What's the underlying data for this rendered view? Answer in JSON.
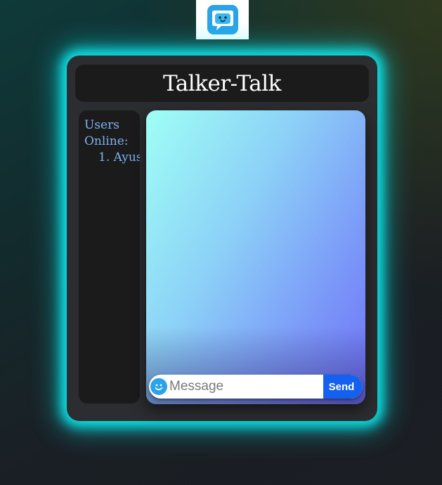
{
  "app": {
    "title": "Talker-Talk"
  },
  "logo": {
    "icon": "chat-bubble-face-icon",
    "color": "#2aa3e8"
  },
  "users_panel": {
    "heading": "Users Online:",
    "users": [
      {
        "number": "1.",
        "name": "Ayus"
      }
    ]
  },
  "chat": {
    "emoji_icon": "smiley-icon",
    "message_placeholder": "Message",
    "message_value": "",
    "send_label": "Send"
  },
  "colors": {
    "accent_glow": "#0fe3e8",
    "send_button": "#1361ee",
    "users_text": "#7fb2ee",
    "chat_gradient_start": "#9ffff5",
    "chat_gradient_end": "#6e72f7"
  }
}
